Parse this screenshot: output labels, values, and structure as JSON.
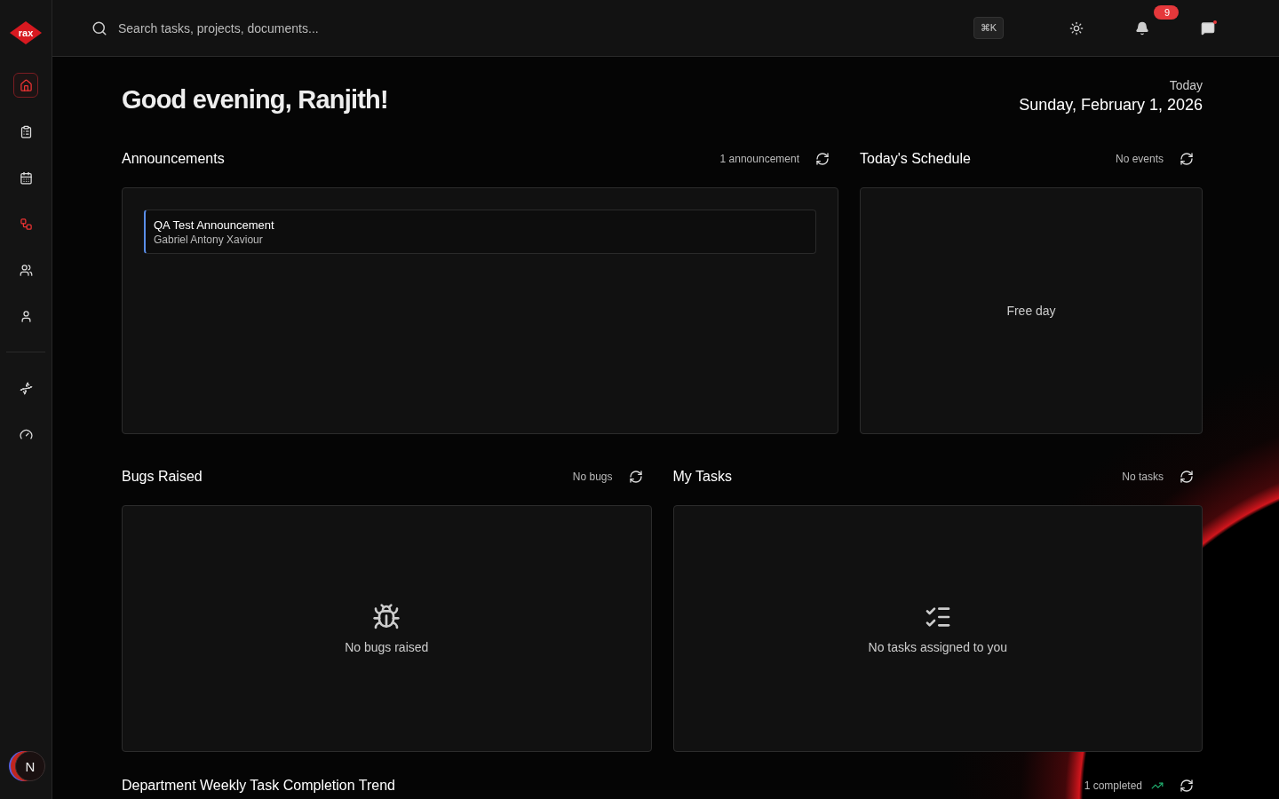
{
  "sidebar": {
    "logo": "rax",
    "items": [
      {
        "kind": "home",
        "selected": true
      },
      {
        "kind": "clipboard",
        "selected": false
      },
      {
        "kind": "calendar",
        "selected": false
      },
      {
        "kind": "workflow",
        "selected": false
      },
      {
        "kind": "team",
        "selected": false
      },
      {
        "kind": "person",
        "selected": false
      }
    ],
    "tools": [
      {
        "kind": "dna",
        "selected": false
      },
      {
        "kind": "gauge",
        "selected": false
      }
    ],
    "avatar": "N"
  },
  "topbar": {
    "search": {
      "placeholder": "Search tasks, projects, documents..."
    },
    "shortcut": "⌘K",
    "notifications": "9",
    "messages_unread": true
  },
  "greeting": "Good evening, Ranjith!",
  "date": {
    "label": "Today",
    "value": "Sunday, February 1, 2026"
  },
  "panels": [
    {
      "kind": "announcements",
      "title": "Announcements",
      "status": "1 announcement",
      "items": [
        {
          "title": "QA Test Announcement",
          "author": "Gabriel Antony Xaviour"
        }
      ]
    },
    {
      "kind": "schedule",
      "title": "Today's Schedule",
      "status": "No events",
      "empty": "Free day"
    },
    {
      "kind": "bugs",
      "title": "Bugs Raised",
      "status": "No bugs",
      "empty": "No bugs raised"
    },
    {
      "kind": "tasks",
      "title": "My Tasks",
      "status": "No tasks",
      "empty": "No tasks assigned to you"
    },
    {
      "kind": "trend",
      "title": "Department Weekly Task Completion Trend",
      "status": "1 completed"
    }
  ]
}
